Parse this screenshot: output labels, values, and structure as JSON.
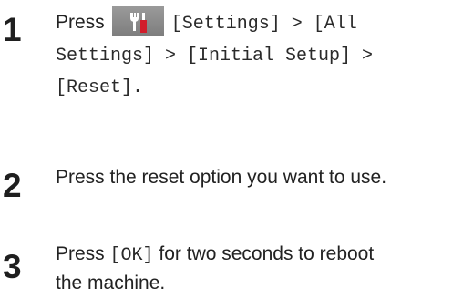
{
  "steps": [
    {
      "number": "1",
      "text_press": "Press",
      "icon": "settings-tools-icon",
      "path": "[Settings] > [All Settings] > [Initial Setup] > [Reset].",
      "path_line1": "[Settings] > [All",
      "path_line2": "Settings] > [Initial Setup] >",
      "path_line3": "[Reset]."
    },
    {
      "number": "2",
      "text": "Press the reset option you want to use."
    },
    {
      "number": "3",
      "text_press": "Press",
      "button": "[OK]",
      "text_rest_line1": "for two seconds to reboot",
      "text_rest_line2": "the machine."
    }
  ],
  "colors": {
    "icon_bg": "#8a8a8a",
    "icon_red": "#d21d2b",
    "icon_white": "#ffffff"
  }
}
